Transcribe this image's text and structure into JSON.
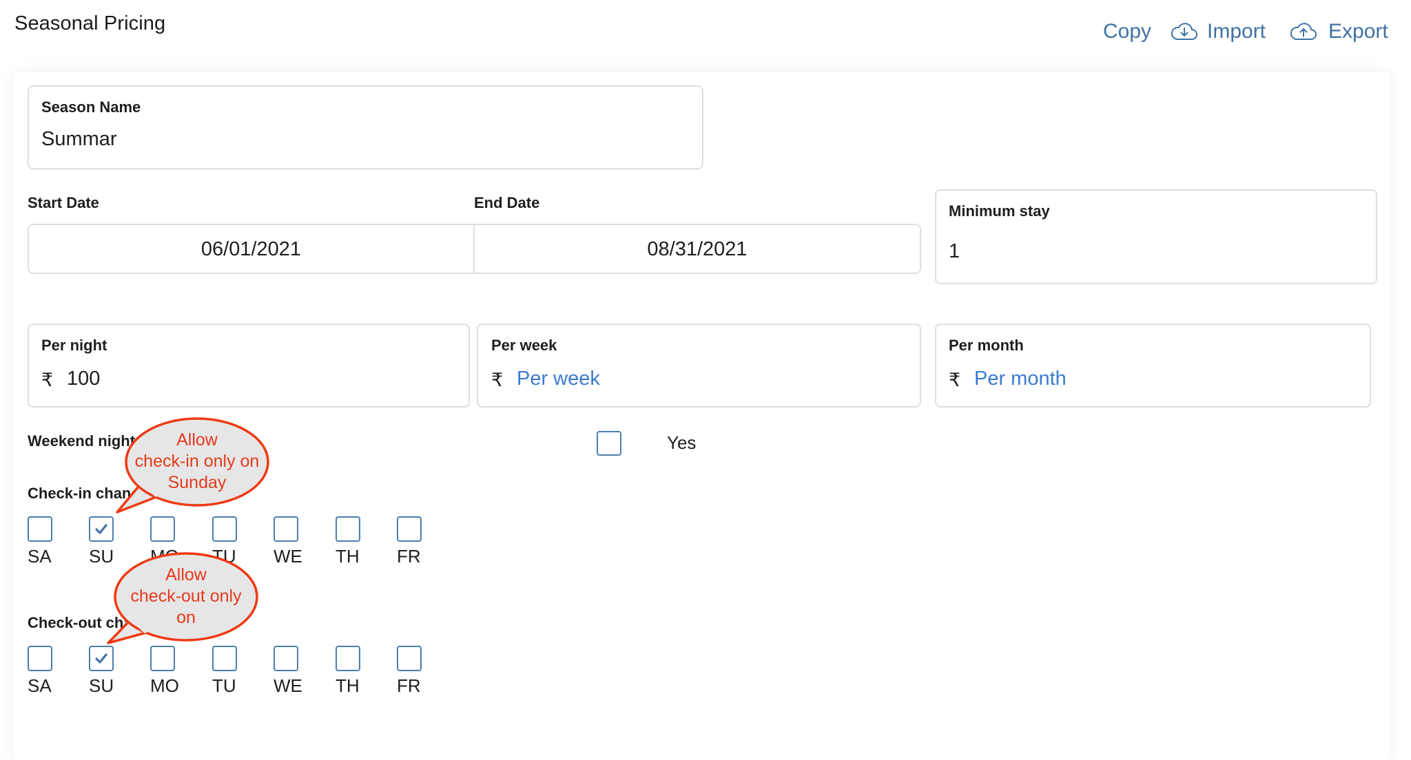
{
  "header": {
    "title": "Seasonal Pricing",
    "actions": [
      {
        "label": "Copy",
        "icon": null
      },
      {
        "label": "Import",
        "icon": "cloud-download-icon"
      },
      {
        "label": "Export",
        "icon": "cloud-upload-icon"
      }
    ]
  },
  "form": {
    "season_name": {
      "label": "Season Name",
      "value": "Summar"
    },
    "start_date": {
      "label": "Start Date",
      "value": "06/01/2021"
    },
    "end_date": {
      "label": "End Date",
      "value": "08/31/2021"
    },
    "minimum_stay": {
      "label": "Minimum stay",
      "value": "1"
    },
    "per_night": {
      "label": "Per night",
      "currency": "₹",
      "value": "100"
    },
    "per_week": {
      "label": "Per week",
      "currency": "₹",
      "placeholder": "Per week"
    },
    "per_month": {
      "label": "Per month",
      "currency": "₹",
      "placeholder": "Per month"
    },
    "weekend": {
      "label": "Weekend night pricing",
      "visible_label_parts": [
        "Weekend night",
        "pricing"
      ],
      "checkbox_label": "Yes",
      "checked": false
    },
    "checkin": {
      "label": "Check-in changeover",
      "visible_label": "Check-in char",
      "days": [
        {
          "label": "SA",
          "checked": false
        },
        {
          "label": "SU",
          "checked": true
        },
        {
          "label": "MO",
          "checked": false
        },
        {
          "label": "TU",
          "checked": false
        },
        {
          "label": "WE",
          "checked": false
        },
        {
          "label": "TH",
          "checked": false
        },
        {
          "label": "FR",
          "checked": false
        }
      ]
    },
    "checkout": {
      "label": "Check-out changeover",
      "visible_label": "Check-out ch",
      "days": [
        {
          "label": "SA",
          "checked": false
        },
        {
          "label": "SU",
          "checked": true
        },
        {
          "label": "MO",
          "checked": false
        },
        {
          "label": "TU",
          "checked": false
        },
        {
          "label": "WE",
          "checked": false
        },
        {
          "label": "TH",
          "checked": false
        },
        {
          "label": "FR",
          "checked": false
        }
      ]
    }
  },
  "annotations": [
    {
      "lines": [
        "Allow",
        "check-in only on",
        "Sunday"
      ]
    },
    {
      "lines": [
        "Allow",
        "check-out only",
        "on"
      ]
    }
  ],
  "colors": {
    "accent": "#3f72a4",
    "placeholder": "#3a7bd0",
    "callout_stroke": "#ef3a14",
    "callout_fill": "#e6e6e6",
    "callout_text": "#e63a1c"
  }
}
